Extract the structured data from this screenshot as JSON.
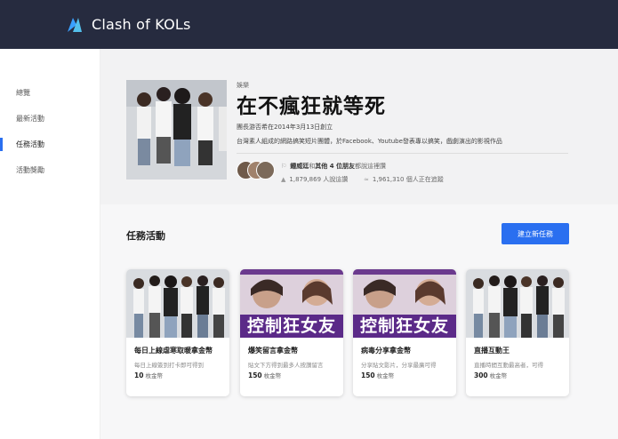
{
  "app": {
    "title": "Clash of KOLs"
  },
  "sidebar": {
    "items": [
      {
        "label": "總覽"
      },
      {
        "label": "最新活動"
      },
      {
        "label": "任務活動"
      },
      {
        "label": "活動獎勵"
      }
    ],
    "active_index": 2
  },
  "hero": {
    "category": "娛樂",
    "title": "在不瘋狂就等死",
    "owner_line": "團長游否希在2014年3月13日創立",
    "description": "台灣素人組成的網路搞笑短片團體，於Facebook、Youtube發表專以搞笑，戲劇演出的影視作品",
    "friends_text_name": "鍾威廷",
    "friends_text_middle": "和",
    "friends_text_count": "其他 4 位朋友",
    "friends_text_tail": "都說這裡讚",
    "likes": "1,879,869 人說這讚",
    "followers": "1,961,310 個人正在追蹤"
  },
  "tasks": {
    "section_title": "任務活動",
    "create_label": "建立新任務",
    "cards": [
      {
        "title": "每日上線虐寒取暖拿金幣",
        "desc": "每日上線簽到打卡即可得到",
        "reward": "10",
        "unit": "枚金幣",
        "image": "group-photo"
      },
      {
        "title": "爆笑留言拿金幣",
        "desc": "貼文下方得到最多人按讚留言",
        "reward": "150",
        "unit": "枚金幣",
        "image": "banner",
        "banner_text": "控制狂女友"
      },
      {
        "title": "病毒分享拿金幣",
        "desc": "分享貼文影片，分享最廣可得",
        "reward": "150",
        "unit": "枚金幣",
        "image": "banner",
        "banner_text": "控制狂女友"
      },
      {
        "title": "直播互動王",
        "desc": "直播時間互動最高者，可得",
        "reward": "300",
        "unit": "枚金幣",
        "image": "group-photo"
      }
    ]
  },
  "colors": {
    "topbar": "#262b3f",
    "accent": "#2a6ff0",
    "banner": "#5b2a88"
  }
}
